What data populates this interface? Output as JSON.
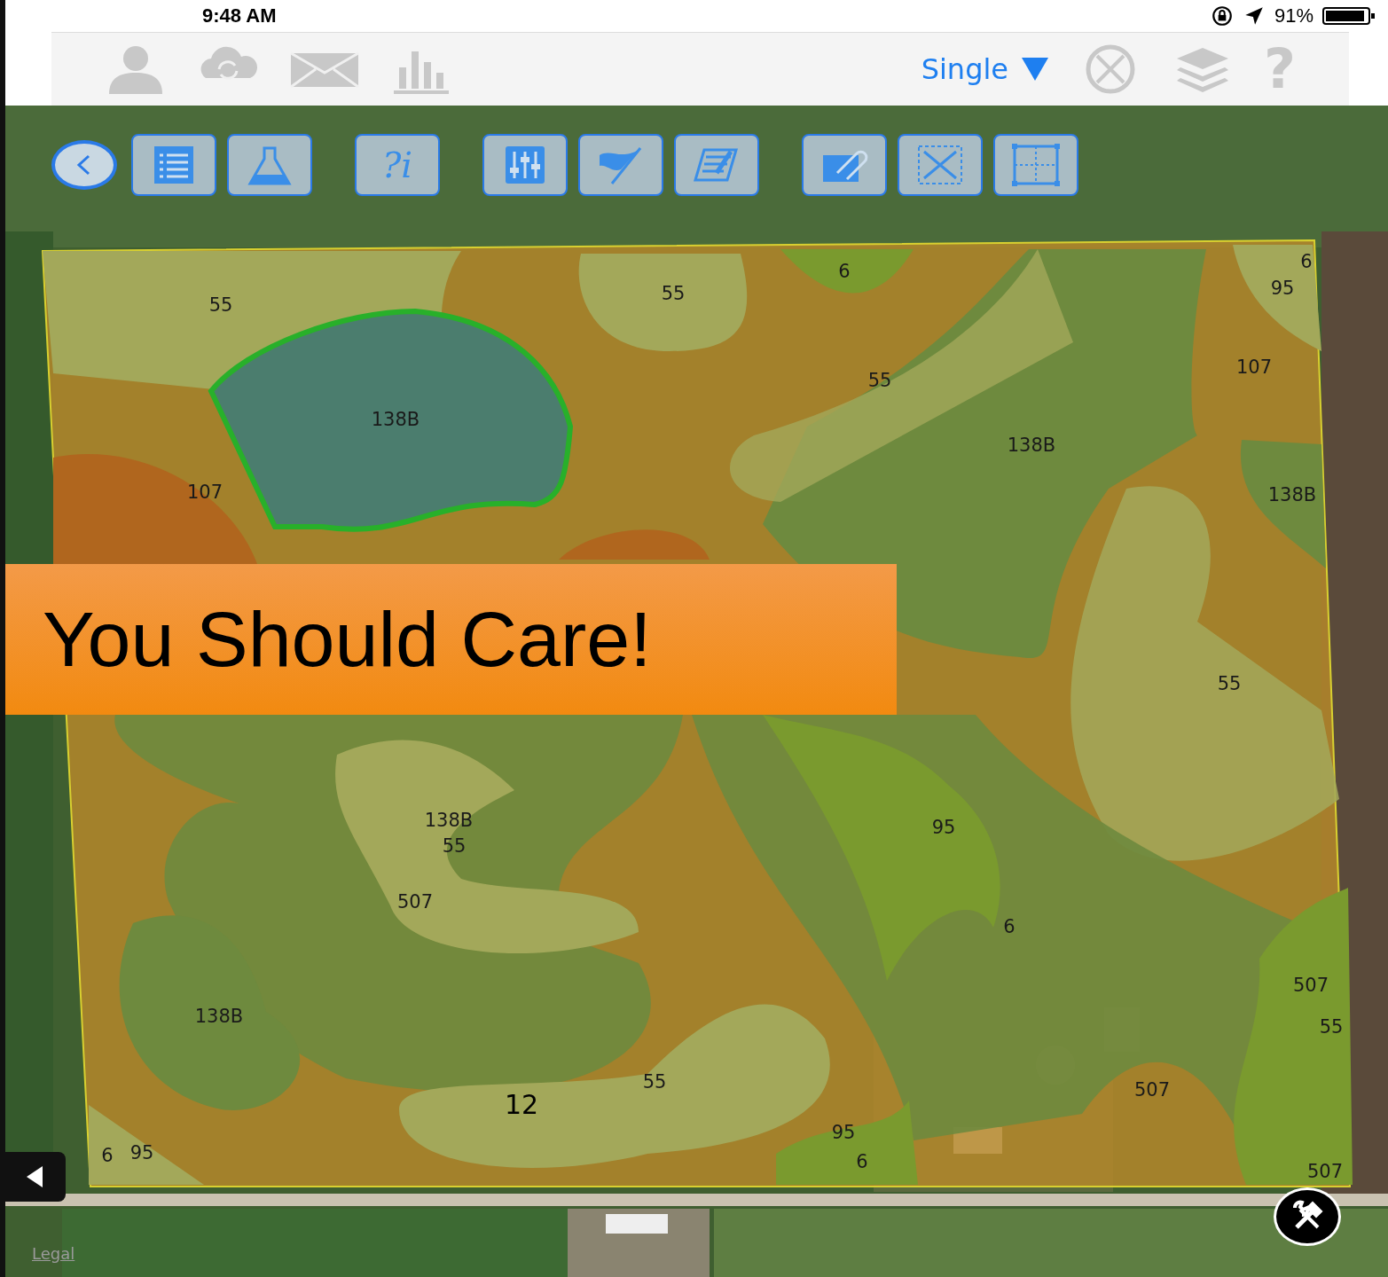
{
  "status_bar": {
    "time": "9:48 AM",
    "battery": "91%"
  },
  "top_toolbar": {
    "mode_selector": "Single",
    "help": "?"
  },
  "map_toolbar": {
    "info_button": "?i"
  },
  "soil_zones": [
    {
      "label": "55"
    },
    {
      "label": "55"
    },
    {
      "label": "6"
    },
    {
      "label": "6"
    },
    {
      "label": "95"
    },
    {
      "label": "55"
    },
    {
      "label": "107"
    },
    {
      "label": "138B"
    },
    {
      "label": "138B"
    },
    {
      "label": "107"
    },
    {
      "label": "138B"
    },
    {
      "label": "55"
    },
    {
      "label": "138B"
    },
    {
      "label": "55"
    },
    {
      "label": "95"
    },
    {
      "label": "507"
    },
    {
      "label": "6"
    },
    {
      "label": "507"
    },
    {
      "label": "138B"
    },
    {
      "label": "55"
    },
    {
      "label": "55"
    },
    {
      "label": "12"
    },
    {
      "label": "507"
    },
    {
      "label": "95"
    },
    {
      "label": "6"
    },
    {
      "label": "6"
    },
    {
      "label": "95"
    },
    {
      "label": "507"
    }
  ],
  "banner": {
    "text": "You Should Care!"
  },
  "legal_link": "Legal"
}
